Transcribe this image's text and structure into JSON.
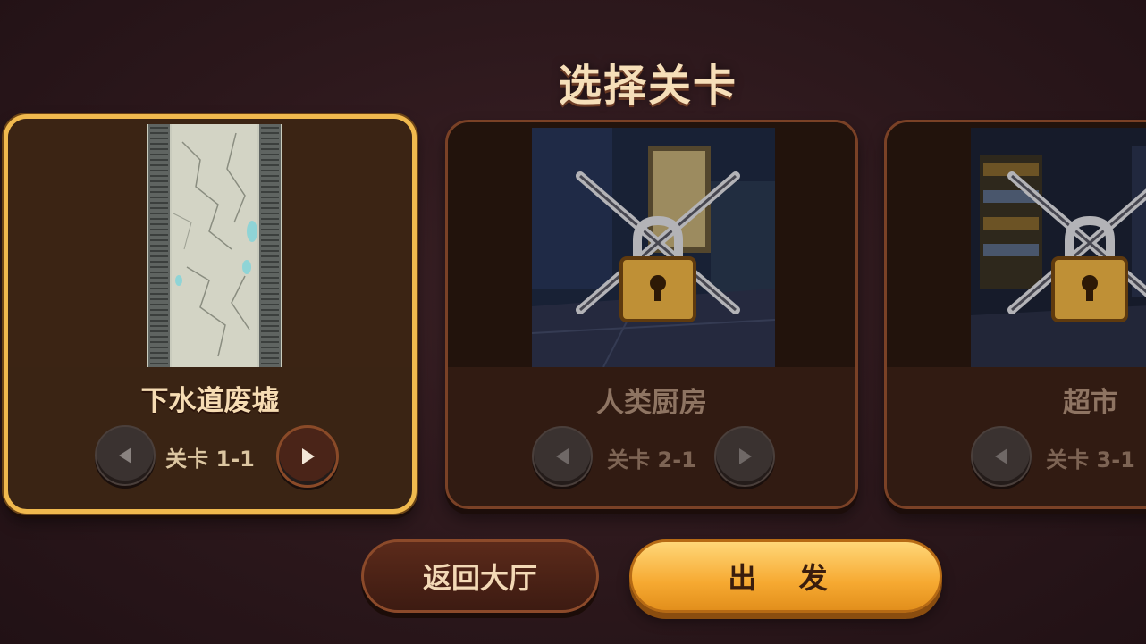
{
  "screen": {
    "title": "选择关卡"
  },
  "levels": [
    {
      "name": "下水道废墟",
      "stage": "关卡 1-1",
      "locked": false,
      "selected": true
    },
    {
      "name": "人类厨房",
      "stage": "关卡 2-1",
      "locked": true,
      "selected": false
    },
    {
      "name": "超市",
      "stage": "关卡 3-1",
      "locked": true,
      "selected": false
    }
  ],
  "buttons": {
    "back": "返回大厅",
    "go": "出 发"
  },
  "icons": {
    "prev": "triangle-left-icon",
    "next": "triangle-right-icon",
    "lock": "padlock-with-chains-icon"
  },
  "colors": {
    "background": "#2b171b",
    "selected_border": "#f0b94e",
    "card_border": "#7a4126",
    "go_button": "#f6a931",
    "lock_gold": "#f5b945"
  }
}
